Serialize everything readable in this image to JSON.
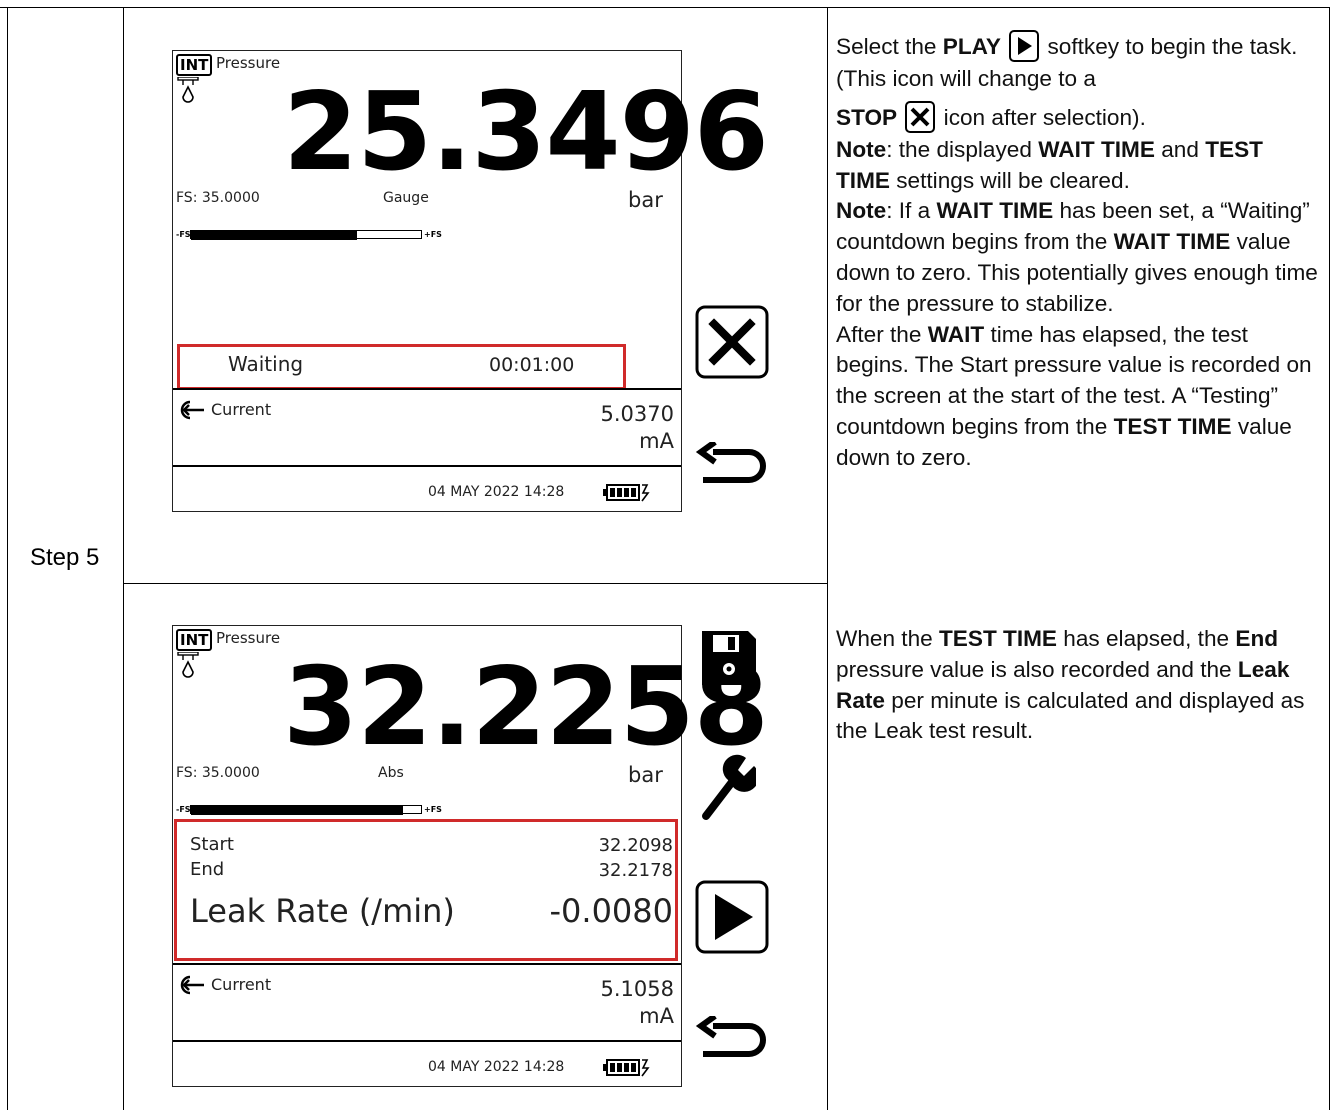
{
  "step_label": "Step 5",
  "screen1": {
    "badge": "INT",
    "label": "Pressure",
    "value": "25.3496",
    "fs": "FS: 35.0000",
    "mode": "Gauge",
    "unit": "bar",
    "bar_fill": 0.72,
    "bar_left": "-FS",
    "bar_right": "+FS",
    "status_label": "Waiting",
    "status_time": "00:01:00",
    "current_label": "Current",
    "current_value": "5.0370",
    "current_unit": "mA",
    "datetime": "04 MAY 2022 14:28"
  },
  "screen2": {
    "badge": "INT",
    "label": "Pressure",
    "value": "32.2258",
    "fs": "FS: 35.0000",
    "mode": "Abs",
    "unit": "bar",
    "bar_fill": 0.92,
    "bar_left": "-FS",
    "bar_right": "+FS",
    "start_label": "Start",
    "start_value": "32.2098",
    "end_label": "End",
    "end_value": "32.2178",
    "leak_label": "Leak Rate (/min)",
    "leak_value": "-0.0080",
    "current_label": "Current",
    "current_value": "5.1058",
    "current_unit": "mA",
    "datetime": "04 MAY 2022 14:28"
  },
  "desc1": {
    "p1_a": "Select the ",
    "p1_play": "PLAY",
    "p1_b": " softkey to begin the task. (This icon will change to a",
    "p1_stop": "STOP",
    "p1_c": " icon after selection).",
    "note1_label": "Note",
    "note1_a": ": the displayed ",
    "note1_wait": "WAIT TIME",
    "note1_b": " and ",
    "note1_test": "TEST TIME",
    "note1_c": " settings will be cleared.",
    "note2_label": "Note",
    "note2_a": ": If a ",
    "note2_wait": "WAIT TIME",
    "note2_b": " has been set, a “Waiting” countdown begins from the ",
    "note2_wait2": "WAIT TIME",
    "note2_c": " value down to zero. This potentially gives enough time for the pressure to stabilize.",
    "p3_a": "After the ",
    "p3_wait": "WAIT",
    "p3_b": " time has elapsed, the test begins. The Start pressure value is recorded on the screen at the start of the test. A “Testing” countdown begins from the ",
    "p3_test": "TEST TIME",
    "p3_c": " value down to zero."
  },
  "desc2": {
    "a": "When the ",
    "test": "TEST TIME",
    "b": " has elapsed, the ",
    "end": "End",
    "c": " pressure value is also recorded and the ",
    "leak": "Leak Rate",
    "d": " per minute is calculated and displayed as the Leak test result."
  }
}
